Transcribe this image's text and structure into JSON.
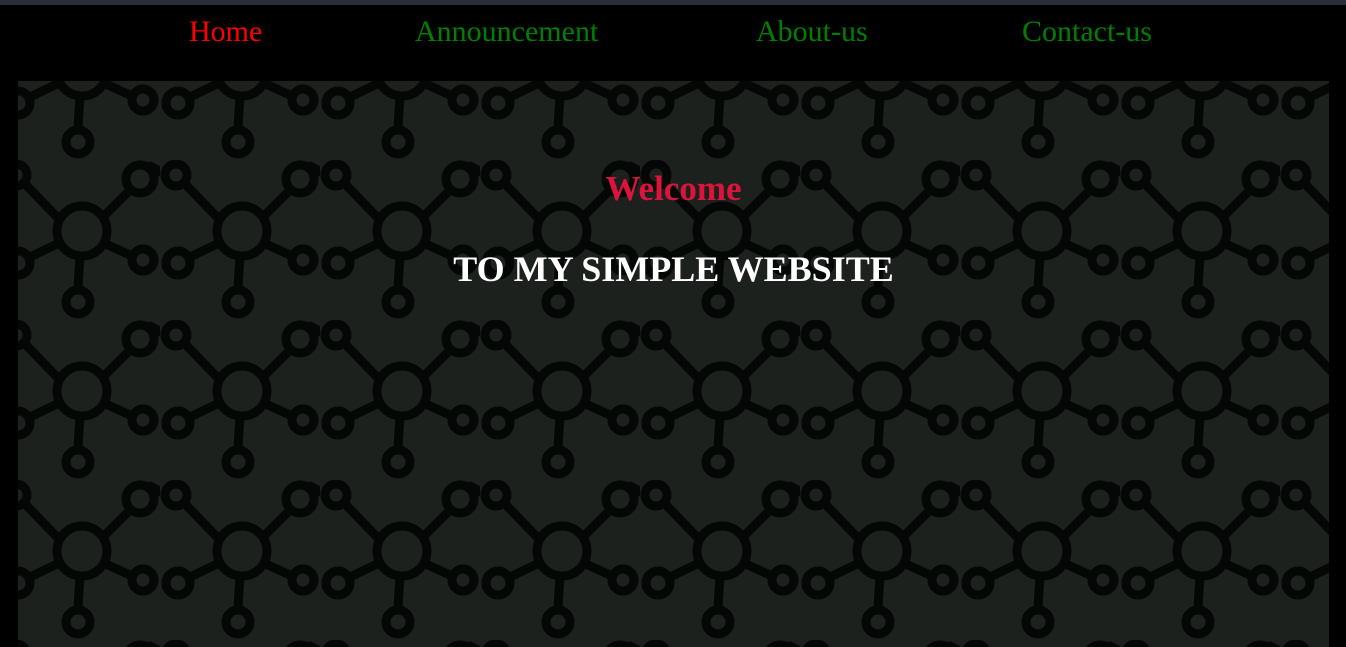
{
  "colors": {
    "page_background": "#000000",
    "top_strip": "#2b2d3a",
    "nav_active": "#ff0000",
    "nav_inactive": "#008000",
    "hero_background": "#1c211d",
    "pattern_stroke": "#050606",
    "welcome": "#dc143c",
    "subtitle": "#ffffff"
  },
  "nav": {
    "items": [
      {
        "label": "Home",
        "active": true
      },
      {
        "label": "Announcement",
        "active": false
      },
      {
        "label": "About-us",
        "active": false
      },
      {
        "label": "Contact-us",
        "active": false
      }
    ]
  },
  "hero": {
    "title": "Welcome",
    "subtitle": "TO MY SIMPLE WEBSITE",
    "background_pattern": "molecule-network-pattern"
  }
}
